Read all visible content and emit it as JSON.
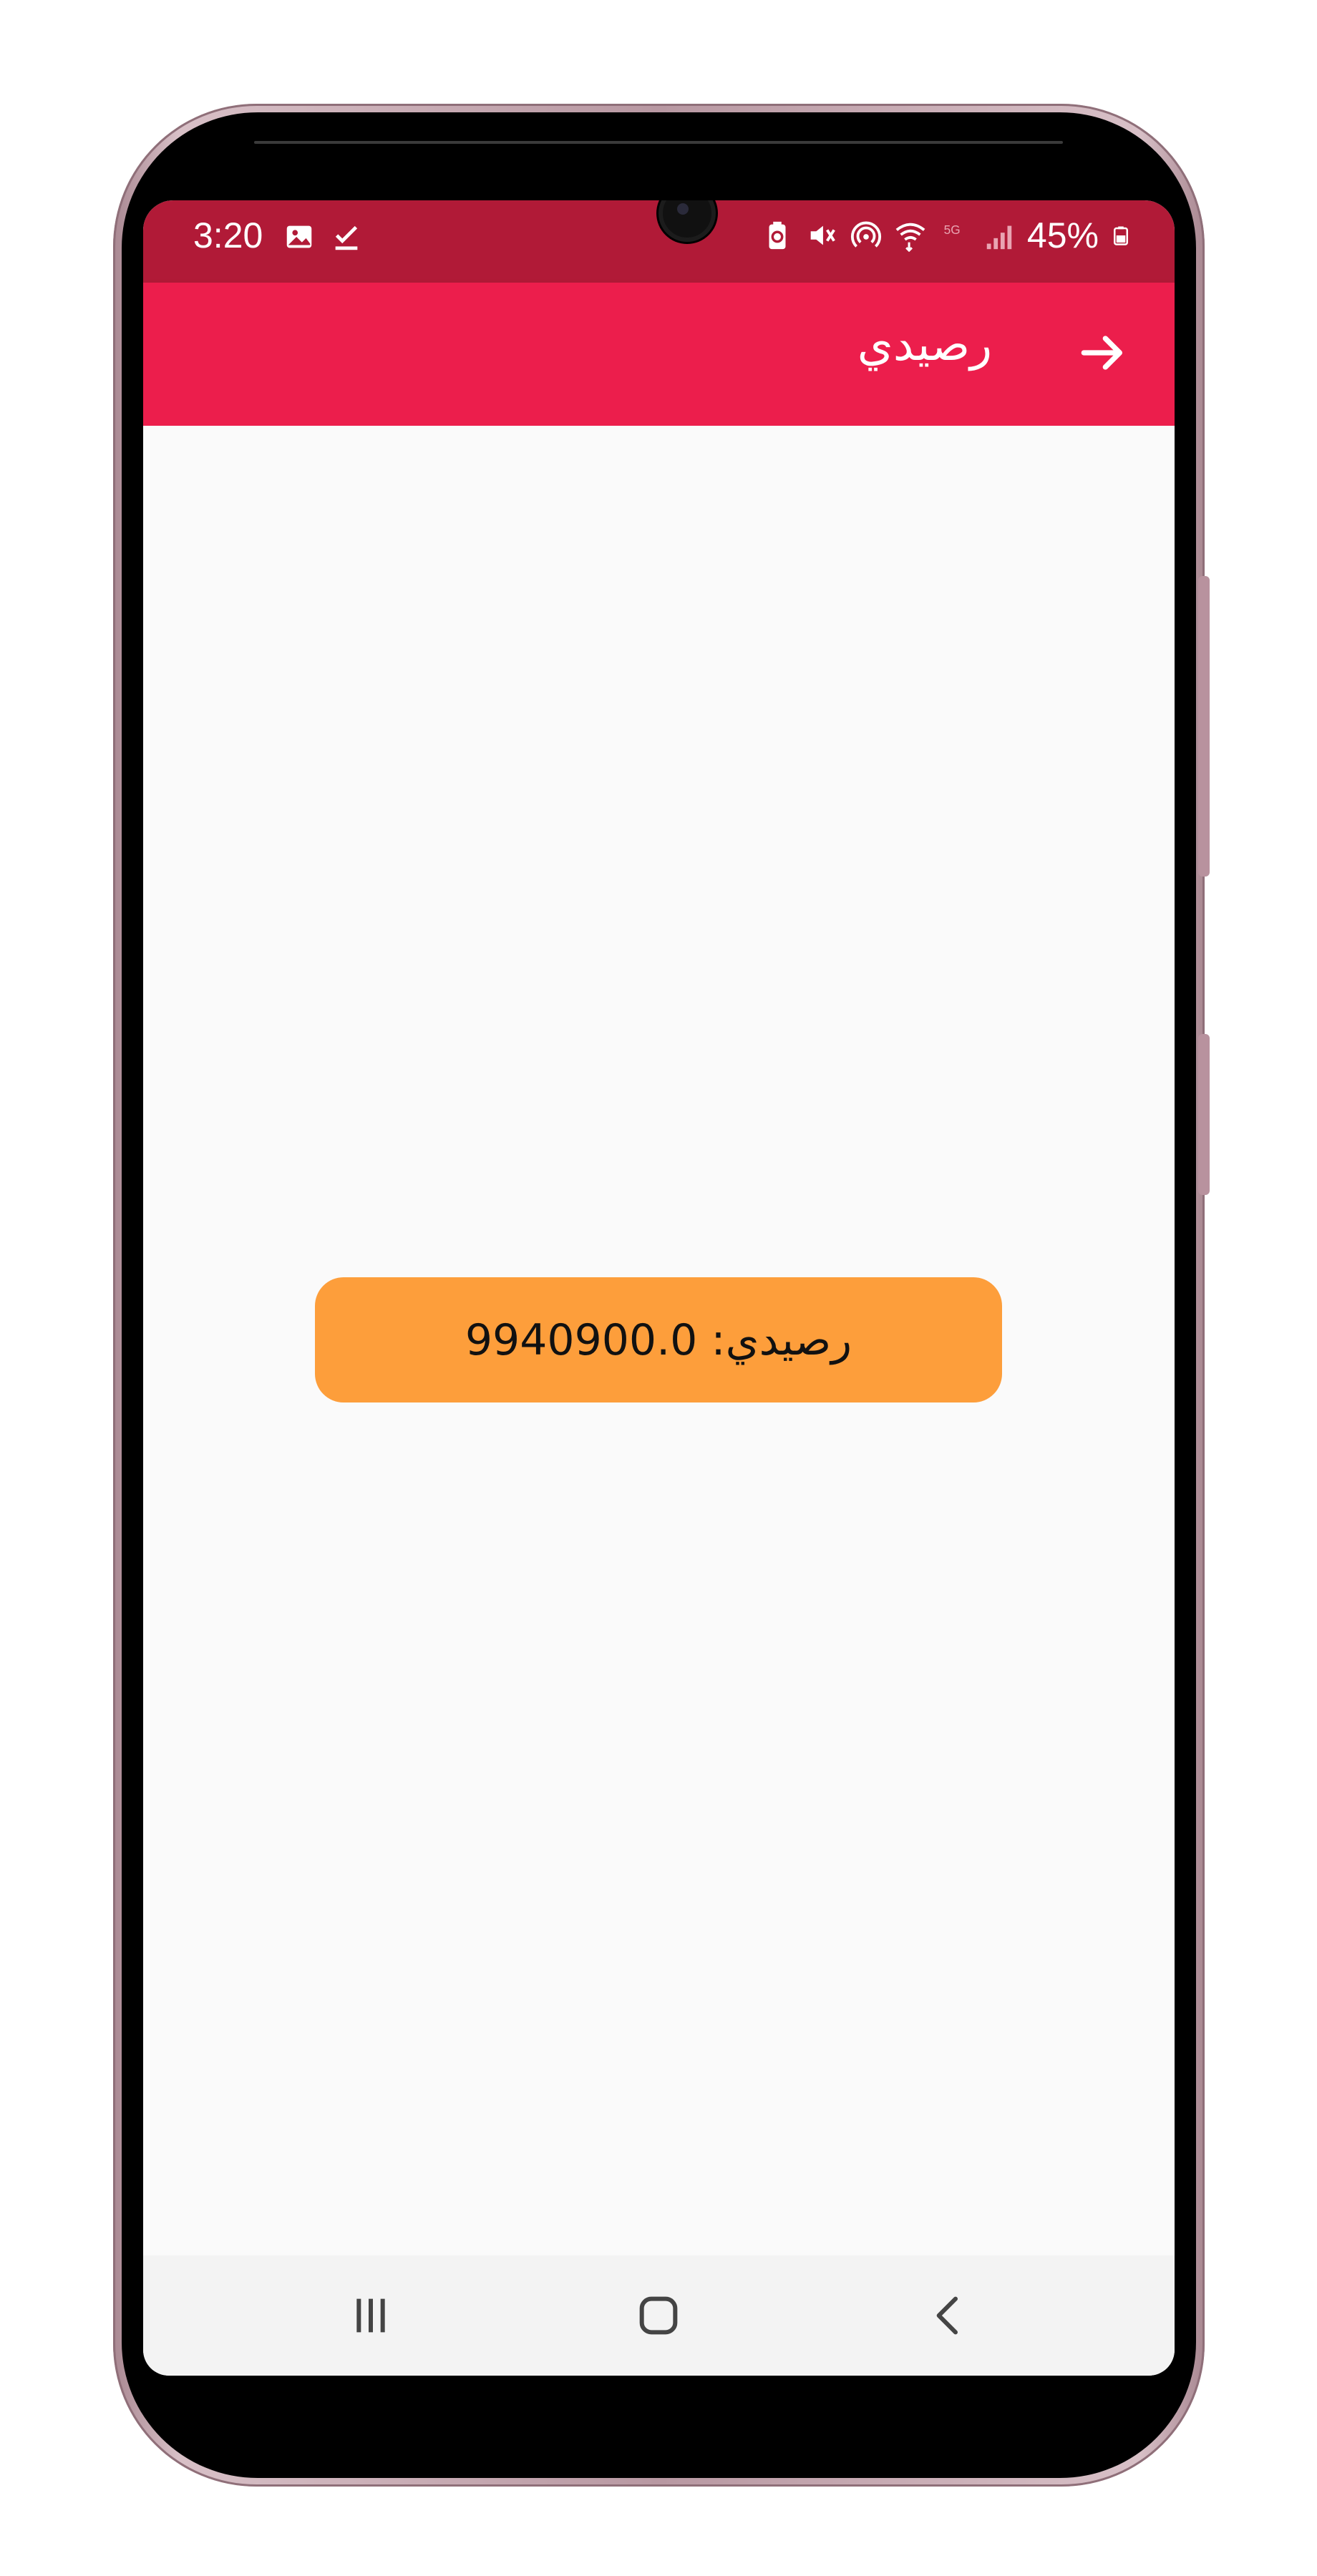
{
  "status_bar": {
    "time": "3:20",
    "battery": "45%",
    "left_icons": [
      "gallery-icon",
      "task-check-icon"
    ],
    "right_icons": [
      "battery-saver-icon",
      "mute-icon",
      "hotspot-icon",
      "wifi-icon",
      "5g-icon",
      "signal-icon",
      "battery-icon"
    ]
  },
  "app_bar": {
    "title": "رصيدي",
    "color": "#ec1e4c",
    "back_icon": "arrow-right-icon"
  },
  "balance": {
    "text": "رصيدي: 9940900.0",
    "card_color": "#fd9e3b"
  },
  "nav_bar": {
    "buttons": [
      "recents-icon",
      "home-icon",
      "back-chevron-icon"
    ]
  }
}
